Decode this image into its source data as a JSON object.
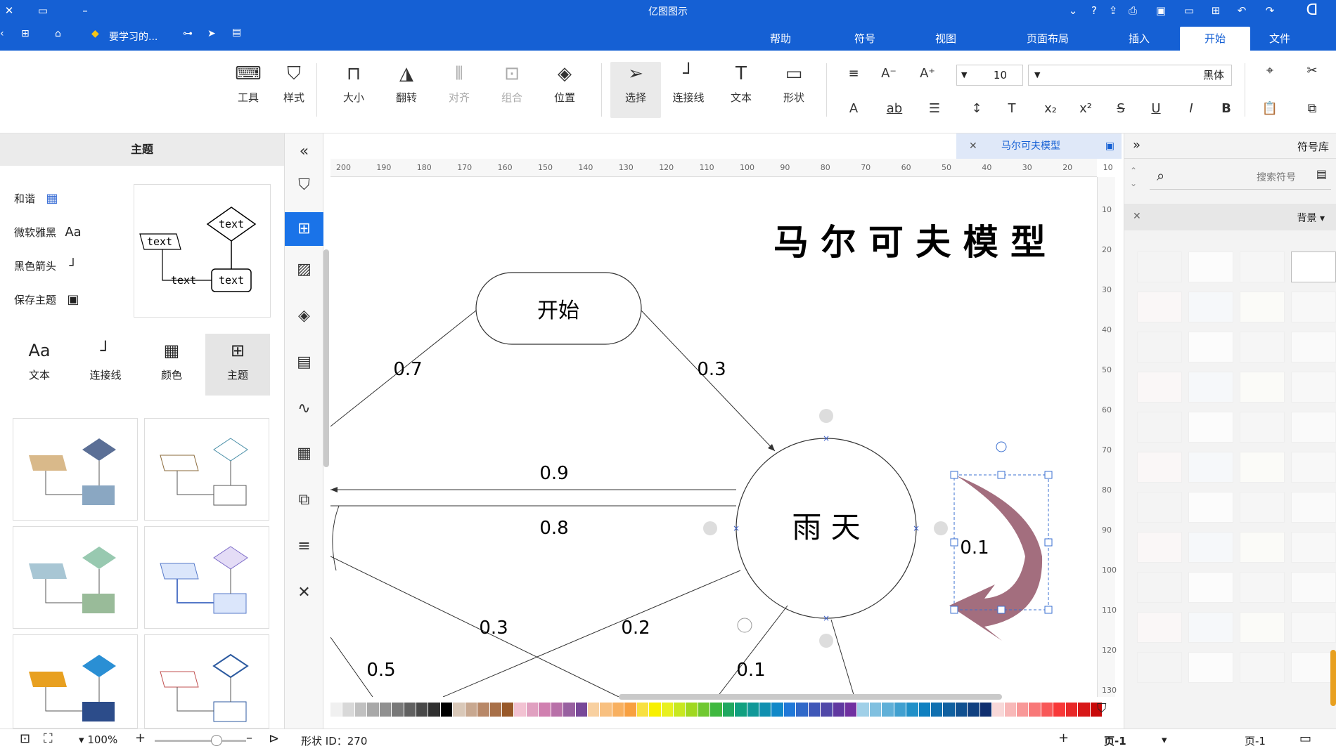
{
  "app": {
    "title": "亿图图示"
  },
  "quick_access": {
    "file_label": "要学习的..."
  },
  "menu": {
    "tabs": [
      {
        "label": "文件"
      },
      {
        "label": "开始"
      },
      {
        "label": "插入"
      },
      {
        "label": "页面布局"
      },
      {
        "label": "视图"
      },
      {
        "label": "符号"
      },
      {
        "label": "帮助"
      }
    ],
    "active": "开始"
  },
  "toolbar": {
    "font_name": "黑体",
    "font_size": "10",
    "tools": [
      {
        "label": "形状"
      },
      {
        "label": "文本"
      },
      {
        "label": "连接线"
      },
      {
        "label": "选择"
      },
      {
        "label": "位置"
      },
      {
        "label": "组合"
      },
      {
        "label": "对齐"
      },
      {
        "label": "翻转"
      },
      {
        "label": "大小"
      },
      {
        "label": "样式"
      },
      {
        "label": "工具"
      }
    ]
  },
  "left_panel": {
    "title": "主题",
    "presets": [
      {
        "label": "和谐",
        "icon": "palette-grid-icon"
      },
      {
        "label": "微软雅黑",
        "icon": "font-aa-icon"
      },
      {
        "label": "黑色箭头",
        "icon": "connector-icon"
      },
      {
        "label": "保存主题",
        "icon": "save-icon"
      }
    ],
    "categories": [
      {
        "label": "主题"
      },
      {
        "label": "颜色"
      },
      {
        "label": "连接线"
      },
      {
        "label": "文本"
      }
    ],
    "preview_text": "text"
  },
  "document": {
    "tab_title": "马尔可夫模型"
  },
  "diagram": {
    "title": "马 尔 可 夫 模 型",
    "nodes": {
      "start": "开始",
      "rain": "雨 天"
    },
    "edges": [
      "0.7",
      "0.3",
      "0.9",
      "0.8",
      "0.1",
      "0.3",
      "0.2",
      "0.5",
      "0.1"
    ]
  },
  "right_panel": {
    "title": "符号库",
    "search_placeholder": "搜索符号",
    "section": "背景"
  },
  "ruler": {
    "top": [
      "200",
      "190",
      "180",
      "170",
      "160",
      "150",
      "140",
      "130",
      "120",
      "110",
      "100",
      "90",
      "80",
      "70",
      "60",
      "50",
      "40",
      "30",
      "20",
      "10"
    ],
    "left": [
      "10",
      "20",
      "30",
      "40",
      "50",
      "60",
      "70",
      "80",
      "90",
      "100",
      "110",
      "120",
      "130"
    ]
  },
  "status": {
    "page_label": "页-1",
    "page_tab": "页-1",
    "shape_id": "形状 ID：270",
    "zoom": "100%"
  },
  "colors": {
    "accent": "#1560d4",
    "arrow": "#a36e7e"
  }
}
